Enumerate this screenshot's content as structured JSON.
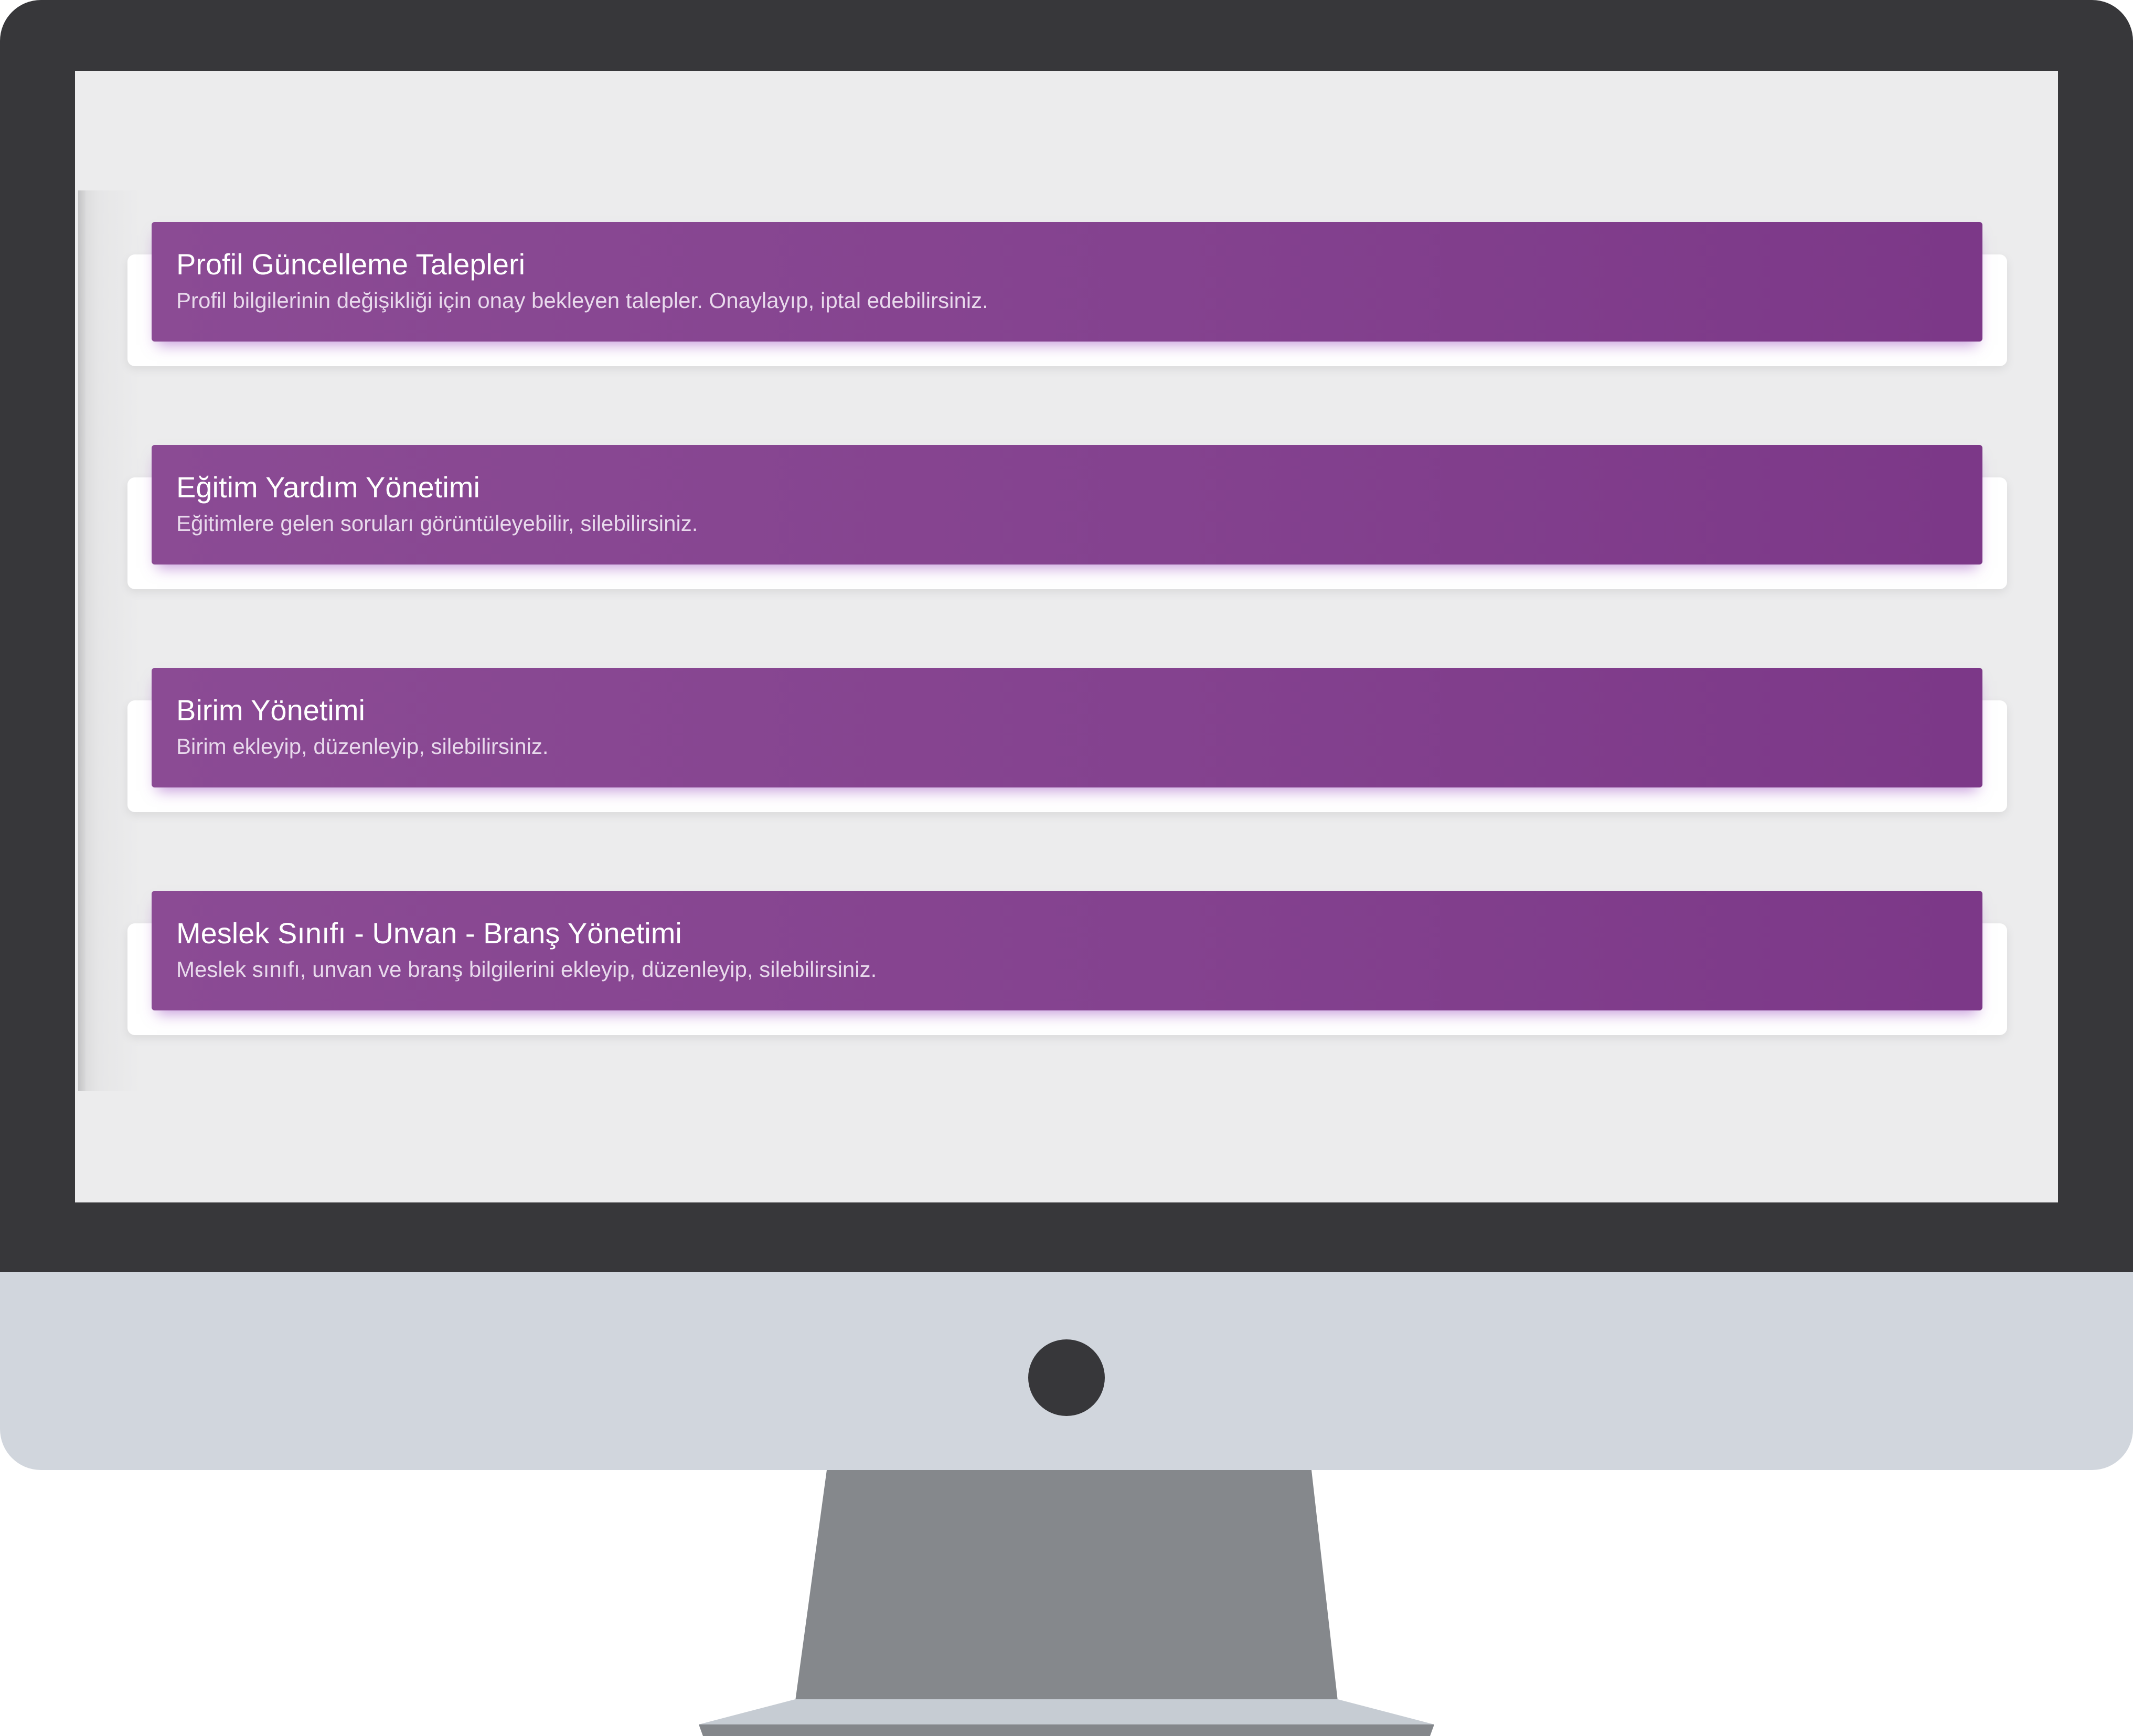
{
  "panels": [
    {
      "title": "Profil Güncelleme Talepleri",
      "description": "Profil bilgilerinin değişikliği için onay bekleyen talepler. Onaylayıp, iptal edebilirsiniz."
    },
    {
      "title": "Eğitim Yardım Yönetimi",
      "description": "Eğitimlere gelen soruları görüntüleyebilir, silebilirsiniz."
    },
    {
      "title": "Birim Yönetimi",
      "description": "Birim ekleyip, düzenleyip, silebilirsiniz."
    },
    {
      "title": "Meslek Sınıfı - Unvan - Branş Yönetimi",
      "description": "Meslek sınıfı, unvan ve branş bilgilerini ekleyip, düzenleyip, silebilirsiniz."
    }
  ],
  "colors": {
    "accent_start": "#8b4b94",
    "accent_end": "#7c3888",
    "screen_background": "#ececed",
    "bezel": "#37373a",
    "chin": "#d1d6dd"
  }
}
